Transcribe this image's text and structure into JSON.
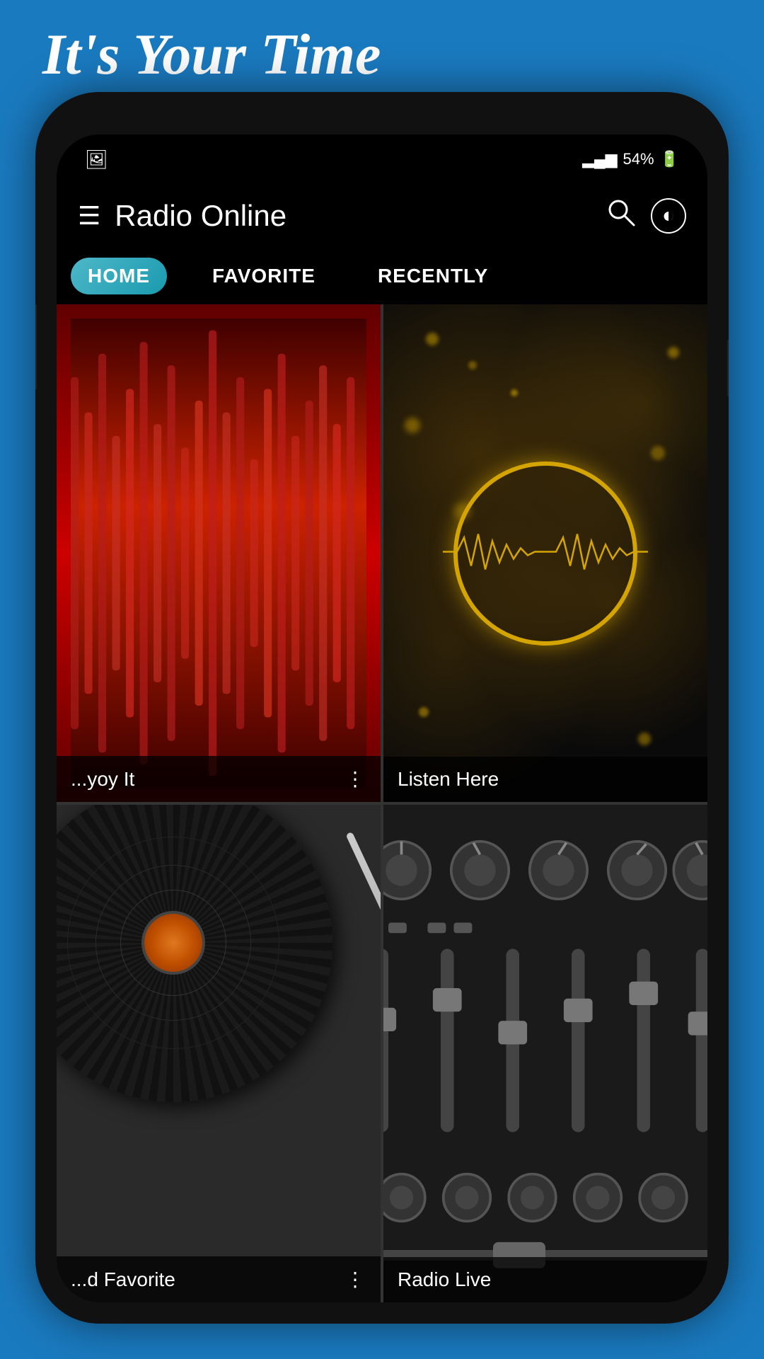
{
  "tagline": "It's Your Time",
  "app": {
    "title": "Radio Online"
  },
  "status_bar": {
    "battery": "54%",
    "signal": "▲▄▄▄"
  },
  "tabs": [
    {
      "id": "home",
      "label": "HOME",
      "active": true
    },
    {
      "id": "favorite",
      "label": "FAVORITE",
      "active": false
    },
    {
      "id": "recently",
      "label": "RECENTLY",
      "active": false
    }
  ],
  "cards": [
    {
      "id": "card1",
      "label": "...yoy It",
      "has_dots": true,
      "type": "red-waveform"
    },
    {
      "id": "card2",
      "label": "Listen Here",
      "has_dots": false,
      "type": "gold-circle"
    },
    {
      "id": "card3",
      "label": "...d Favorite",
      "has_dots": true,
      "type": "vinyl"
    },
    {
      "id": "card4",
      "label": "Radio Live",
      "has_dots": false,
      "type": "mixer"
    }
  ],
  "icons": {
    "hamburger": "☰",
    "search": "⌕",
    "more": "⋮"
  },
  "colors": {
    "background": "#1a7abf",
    "phone_bg": "#111",
    "screen_bg": "#1a1a1a",
    "header_bg": "#000",
    "active_tab": "#1a9aaf",
    "text_white": "#ffffff",
    "red_card": "#8b0000",
    "gold": "#d4a500"
  }
}
